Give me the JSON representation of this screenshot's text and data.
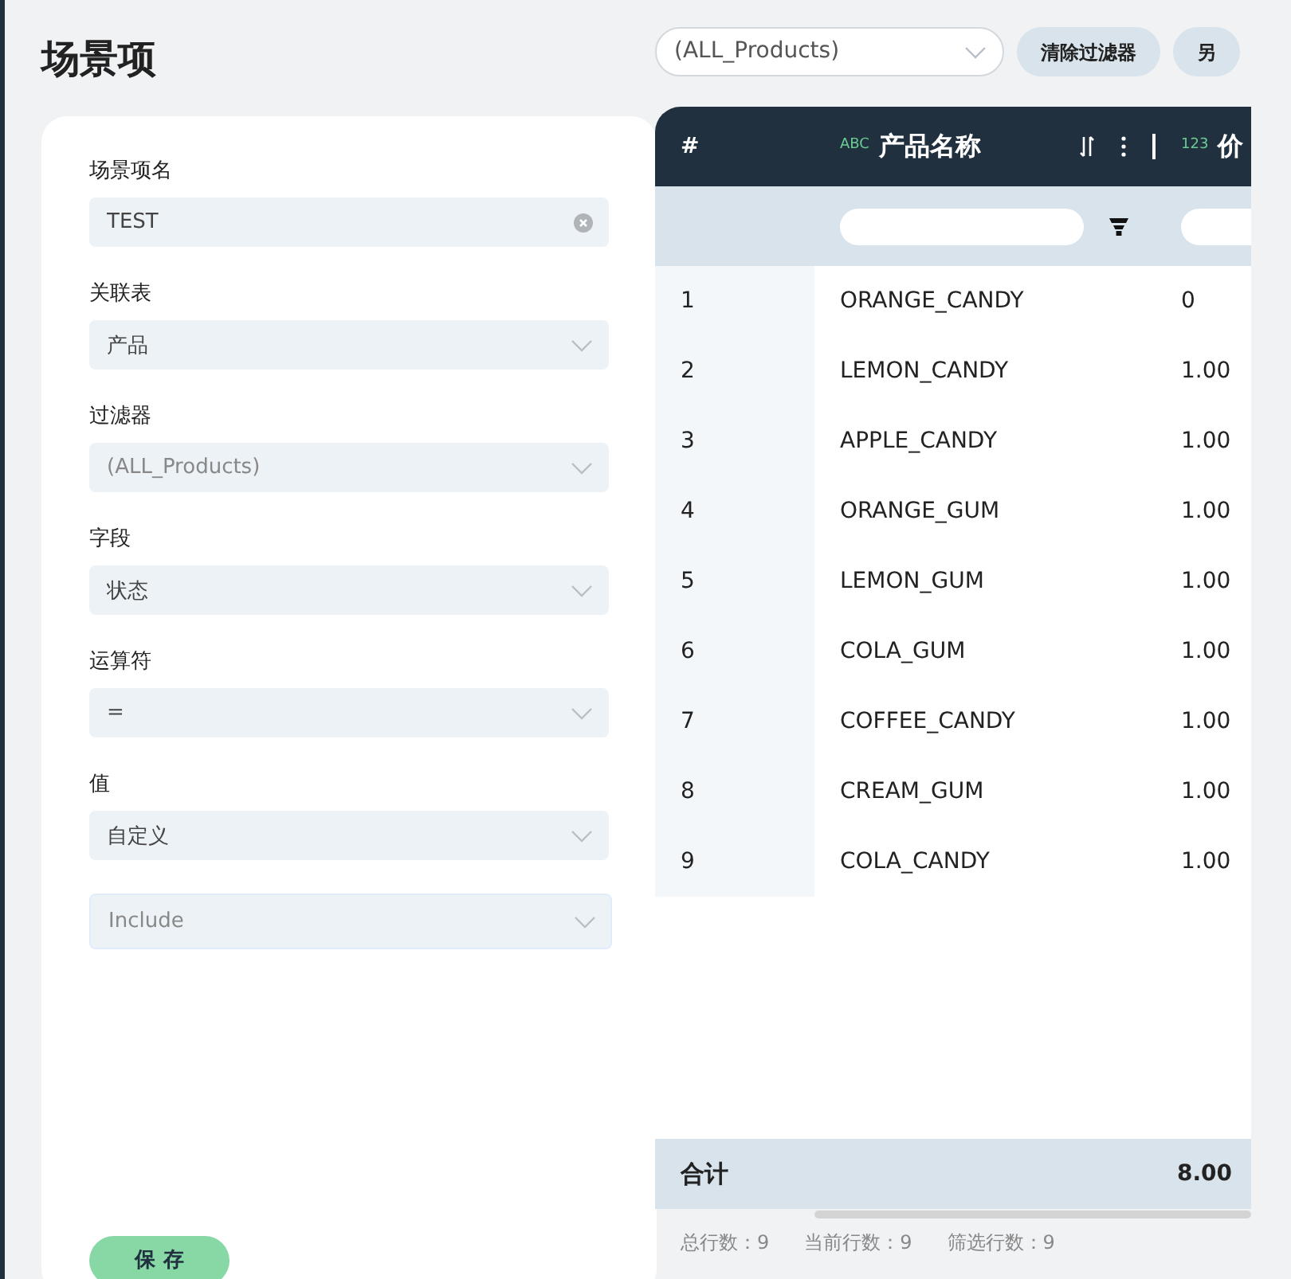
{
  "page_title": "场景项",
  "form": {
    "fields": [
      {
        "label": "场景项名",
        "kind": "text",
        "value": "TEST",
        "clearable": true
      },
      {
        "label": "关联表",
        "kind": "select",
        "value": "产品"
      },
      {
        "label": "过滤器",
        "kind": "select",
        "placeholder": "(ALL_Products)"
      },
      {
        "label": "字段",
        "kind": "select",
        "value": "状态"
      },
      {
        "label": "运算符",
        "kind": "select",
        "value": "="
      },
      {
        "label": "值",
        "kind": "select",
        "value": "自定义"
      },
      {
        "kind": "select",
        "placeholder": "Include"
      }
    ],
    "save_button": "保 存"
  },
  "toolbar": {
    "filter_select": {
      "value": "(ALL_Products)"
    },
    "buttons": [
      "清除过滤器",
      "另"
    ]
  },
  "table": {
    "columns": [
      {
        "label": "#"
      },
      {
        "type_tag": "ABC",
        "label": "产品名称"
      },
      {
        "type_tag": "123",
        "label": "价"
      }
    ],
    "rows": [
      [
        "1",
        "ORANGE_CANDY",
        "0"
      ],
      [
        "2",
        "LEMON_CANDY",
        "1.00"
      ],
      [
        "3",
        "APPLE_CANDY",
        "1.00"
      ],
      [
        "4",
        "ORANGE_GUM",
        "1.00"
      ],
      [
        "5",
        "LEMON_GUM",
        "1.00"
      ],
      [
        "6",
        "COLA_GUM",
        "1.00"
      ],
      [
        "7",
        "COFFEE_CANDY",
        "1.00"
      ],
      [
        "8",
        "CREAM_GUM",
        "1.00"
      ],
      [
        "9",
        "COLA_CANDY",
        "1.00"
      ]
    ],
    "total": {
      "label": "合计",
      "value": "8.00"
    }
  },
  "status_bar": [
    "总行数：9",
    "当前行数：9",
    "筛选行数：9"
  ]
}
